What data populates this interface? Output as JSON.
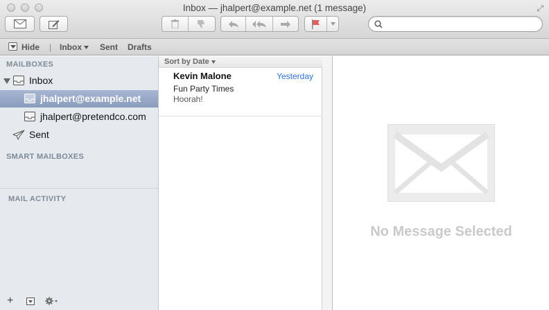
{
  "window": {
    "title": "Inbox — jhalpert@example.net (1 message)"
  },
  "toolbar": {
    "get_mail_icon": "envelope-icon",
    "compose_icon": "compose-icon",
    "delete_icon": "trash-icon",
    "junk_icon": "thumbs-down-icon",
    "reply_icon": "reply-icon",
    "reply_all_icon": "reply-all-icon",
    "forward_icon": "forward-icon",
    "flag_icon": "flag-icon",
    "search_placeholder": ""
  },
  "favorites": {
    "hide_label": "Hide",
    "inbox_label": "Inbox",
    "sent_label": "Sent",
    "drafts_label": "Drafts"
  },
  "sidebar": {
    "mailboxes_header": "MAILBOXES",
    "inbox_label": "Inbox",
    "accounts": [
      "jhalpert@example.net",
      "jhalpert@pretendco.com"
    ],
    "sent_label": "Sent",
    "smart_header": "SMART MAILBOXES",
    "activity_header": "MAIL ACTIVITY",
    "add_label": "+"
  },
  "list": {
    "sort_label": "Sort by Date",
    "messages": [
      {
        "from": "Kevin Malone",
        "date": "Yesterday",
        "subject": "Fun Party Times",
        "preview": "Hoorah!"
      }
    ]
  },
  "reader": {
    "empty_text": "No Message Selected"
  },
  "colors": {
    "selection": "#98a9c8",
    "date_link": "#2e74d6",
    "placeholder_text": "#c9c9c9"
  }
}
